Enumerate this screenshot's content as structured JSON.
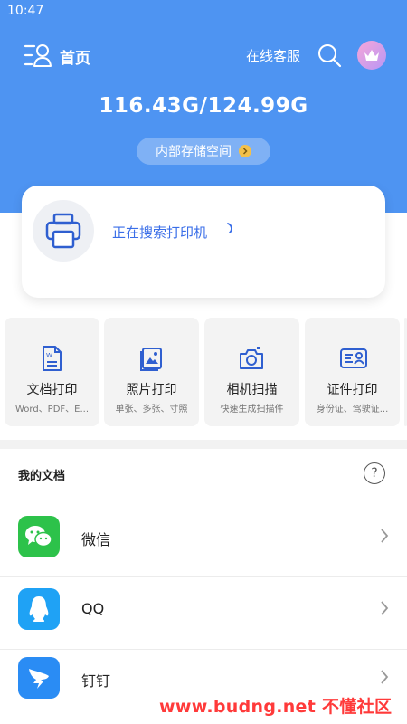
{
  "status_bar": {
    "time": "10:47"
  },
  "header": {
    "title": "首页",
    "service_label": "在线客服",
    "icons": {
      "menu": "user-list-icon",
      "search": "search-icon",
      "vip": "crown-icon"
    }
  },
  "storage": {
    "value": "116.43G/124.99G",
    "button_label": "内部存储空间"
  },
  "printer": {
    "status": "正在搜索打印机",
    "icon": "printer-icon"
  },
  "tools": [
    {
      "title": "文档打印",
      "subtitle": "Word、PDF、E...",
      "icon": "document-icon"
    },
    {
      "title": "照片打印",
      "subtitle": "单张、多张、寸照",
      "icon": "photo-icon"
    },
    {
      "title": "相机扫描",
      "subtitle": "快速生成扫描件",
      "icon": "camera-icon"
    },
    {
      "title": "证件打印",
      "subtitle": "身份证、驾驶证...",
      "icon": "id-card-icon"
    }
  ],
  "documents": {
    "header": "我的文档",
    "help_symbol": "?",
    "items": [
      {
        "label": "微信",
        "icon": "wechat-icon",
        "color": "#2dc24a"
      },
      {
        "label": "QQ",
        "icon": "qq-icon",
        "color": "#1fa2f5"
      },
      {
        "label": "钉钉",
        "icon": "dingtalk-icon",
        "color": "#2a8cf4"
      }
    ]
  },
  "watermark": "www.budng.net 不懂社区",
  "colors": {
    "primary": "#4e94f2",
    "link": "#3a6ee8",
    "tool_bg": "#f3f3f3"
  }
}
